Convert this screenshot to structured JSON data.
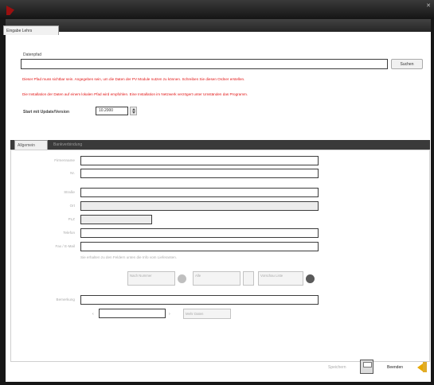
{
  "tabs": {
    "main": "Eingabe Lehrs"
  },
  "section": {
    "path_label": "Datenpfad",
    "path_value": "",
    "browse_label": "Suchen",
    "warning_1": "Dieser Pfad muss sichtbar sein. Angegeben sein, um die Daten der PV Module nutzen zu können. Schreiben Sie diesen Ordner erstellen.",
    "warning_2": "Die Installation der Daten auf einem lokalen Pfad wird empfohlen. Eine Installation im Netzwerk verzögert unter Umständen das Programm.",
    "start_label": "Start mit Update/Version",
    "start_value": "10.2000"
  },
  "subtabs": {
    "active": "Allgemein",
    "inactive": "Bankverbindung"
  },
  "form": {
    "labels": [
      "Firmenname",
      "Nr.",
      "Straße",
      "Ort",
      "PLZ",
      "Telefon",
      "Fax / E-Mail"
    ],
    "hint": "Sie erhalten zu den Feldern unten die Info vom Lieferanten.",
    "btn_a": "Nach Nummer",
    "btn_b": "Alle",
    "btn_c": "Vorschau Liste",
    "lower_label": "Bemerkung",
    "small_label": "Mehr Daten",
    "lower_val1": "",
    "lower_val2": ""
  },
  "footer": {
    "secondary_label": "Speichern",
    "primary_label": "Beenden"
  },
  "icons": {
    "logo": "app-logo",
    "save": "save-disk-icon",
    "exit": "exit-arrow-icon",
    "cog": "settings-gear-icon"
  },
  "colors": {
    "warning": "#e21313",
    "accent": "#e8a900"
  }
}
